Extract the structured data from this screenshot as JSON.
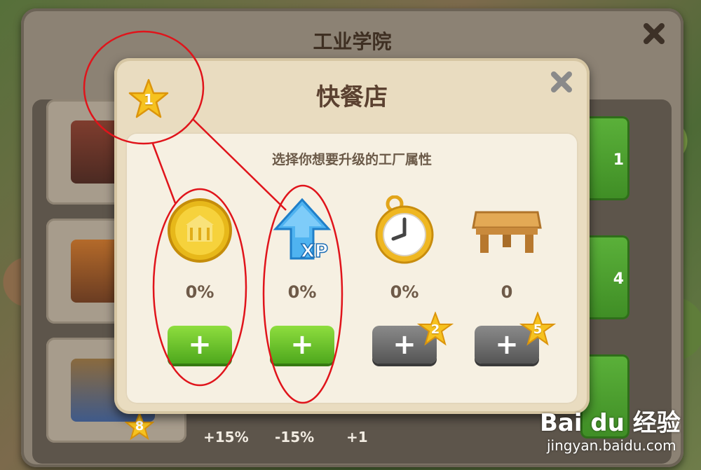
{
  "outer_window": {
    "title": "工业学院",
    "close_icon": "close-icon",
    "bg_counts": [
      "1",
      "4"
    ],
    "bg_level_badge": "8",
    "bg_stats": [
      "+15%",
      "-15%",
      "+1"
    ]
  },
  "dialog": {
    "title": "快餐店",
    "level": "1",
    "close_icon": "close-icon",
    "prompt": "选择你想要升级的工厂属性",
    "attributes": [
      {
        "icon": "coin-icon",
        "value": "0%",
        "button_style": "green",
        "required_level": null
      },
      {
        "icon": "xp-arrow-icon",
        "value": "0%",
        "button_style": "green",
        "required_level": null
      },
      {
        "icon": "stopwatch-icon",
        "value": "0%",
        "button_style": "gray",
        "required_level": "2"
      },
      {
        "icon": "table-icon",
        "value": "0",
        "button_style": "gray",
        "required_level": "5"
      }
    ],
    "plus_label": "+"
  },
  "watermark": {
    "brand": "Bai du 经验",
    "url": "jingyan.baidu.com"
  },
  "colors": {
    "annotation": "#e0141b",
    "star": "#f6c21f",
    "green_button": "#5cb82a",
    "gray_button": "#6d6d6d"
  }
}
